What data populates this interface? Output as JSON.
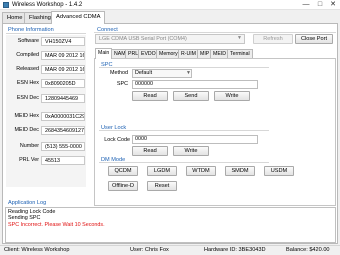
{
  "window": {
    "title": "Wireless Workshop - 1.4.2",
    "minimize_glyph": "—",
    "maximize_glyph": "□",
    "close_glyph": "✕"
  },
  "main_tabs": [
    "Home",
    "Flashing",
    "Advanced CDMA"
  ],
  "phone_info": {
    "heading": "Phone Information",
    "rows": [
      {
        "label": "Software",
        "value": "VH150ZV4"
      },
      {
        "label": "Compiled",
        "value": "MAR 09 2012 16:55:01"
      },
      {
        "label": "Released",
        "value": "MAR 09 2012 16:55:01"
      },
      {
        "label": "ESN Hex",
        "value": "0x8090205D"
      },
      {
        "label": "ESN Dec",
        "value": "12809445469"
      },
      {
        "label": "MEID Hex",
        "value": "0xA0000031C294B2"
      },
      {
        "label": "MEID Dec",
        "value": "268435460912752050"
      },
      {
        "label": "Number",
        "value": "(513) 555-0000"
      },
      {
        "label": "PRL Ver",
        "value": "45513"
      }
    ]
  },
  "connect": {
    "heading": "Connect",
    "port_selected": "LGE CDMA USB Serial Port (COM4)",
    "refresh_label": "Refresh",
    "close_port_label": "Close Port"
  },
  "sub_tabs": [
    "Main",
    "NAM",
    "PRL",
    "EVDO",
    "Memory",
    "R-UIM",
    "MIP",
    "MEID",
    "Terminal"
  ],
  "spc": {
    "heading": "SPC",
    "method_label": "Method",
    "method_value": "Default",
    "spc_label": "SPC",
    "spc_value": "000000",
    "read_label": "Read",
    "send_label": "Send",
    "write_label": "Write"
  },
  "user_lock": {
    "heading": "User Lock",
    "lock_code_label": "Lock Code",
    "lock_code_value": "0000",
    "read_label": "Read",
    "write_label": "Write"
  },
  "dm_mode": {
    "heading": "DM Mode",
    "buttons": [
      "QCDM",
      "LGDM",
      "WTDM",
      "SMDM",
      "USDM",
      "Offline-D",
      "Reset"
    ]
  },
  "app_log": {
    "heading": "Application Log",
    "lines": [
      {
        "text": "Reading Lock Code",
        "color": "#000000"
      },
      {
        "text": "Sending SPC",
        "color": "#000000"
      },
      {
        "text": "SPC Incorrect. Please Wait 10 Seconds.",
        "color": "#e01010"
      }
    ]
  },
  "status": {
    "client": "Client: Wireless Workshop",
    "user": "User: Chris Fox",
    "hardware": "Hardware ID: 3BE3043D",
    "balance": "Balance: $420.00"
  },
  "colors": {
    "heading_blue": "#1c60b3",
    "error_red": "#e01010"
  }
}
